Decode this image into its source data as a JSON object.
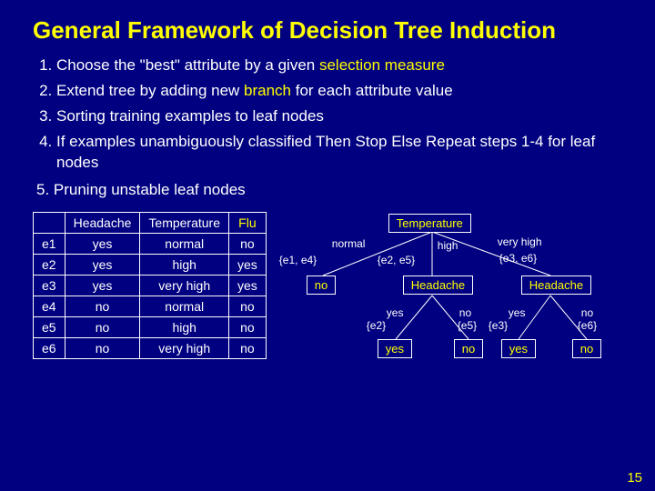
{
  "title": "General Framework of Decision Tree Induction",
  "steps": {
    "s1a": "Choose the \"best\" attribute by a given ",
    "s1b": "selection measure",
    "s2a": "Extend tree by adding new ",
    "s2b": "branch",
    "s2c": " for each attribute value",
    "s3": "Sorting training examples to leaf nodes",
    "s4": "If examples unambiguously classified Then Stop Else Repeat steps 1-4 for leaf nodes"
  },
  "aside": "5. Pruning unstable leaf nodes",
  "table": {
    "headers": {
      "c0": "",
      "c1": "Headache",
      "c2": "Temperature",
      "c3": "Flu"
    },
    "rows": [
      {
        "id": "e1",
        "h": "yes",
        "t": "normal",
        "f": "no"
      },
      {
        "id": "e2",
        "h": "yes",
        "t": "high",
        "f": "yes"
      },
      {
        "id": "e3",
        "h": "yes",
        "t": "very high",
        "f": "yes"
      },
      {
        "id": "e4",
        "h": "no",
        "t": "normal",
        "f": "no"
      },
      {
        "id": "e5",
        "h": "no",
        "t": "high",
        "f": "no"
      },
      {
        "id": "e6",
        "h": "no",
        "t": "very high",
        "f": "no"
      }
    ]
  },
  "tree": {
    "root": "Temperature",
    "edges": {
      "e1": "normal",
      "e2": "high",
      "e3": "very high"
    },
    "splits": {
      "s1": "{e1, e4}",
      "s2": "{e2, e5}",
      "s3": "{e3, e6}"
    },
    "child1": "no",
    "child2": "Headache",
    "child3": "Headache",
    "h_edges": {
      "y": "yes",
      "n": "no"
    },
    "h2_sets": {
      "y": "{e2}",
      "n": "{e5}"
    },
    "h3_sets": {
      "y": "{e3}",
      "n": "{e6}"
    },
    "leaves": {
      "l1": "yes",
      "l2": "no",
      "l3": "yes",
      "l4": "no"
    }
  },
  "pagenum": "15"
}
